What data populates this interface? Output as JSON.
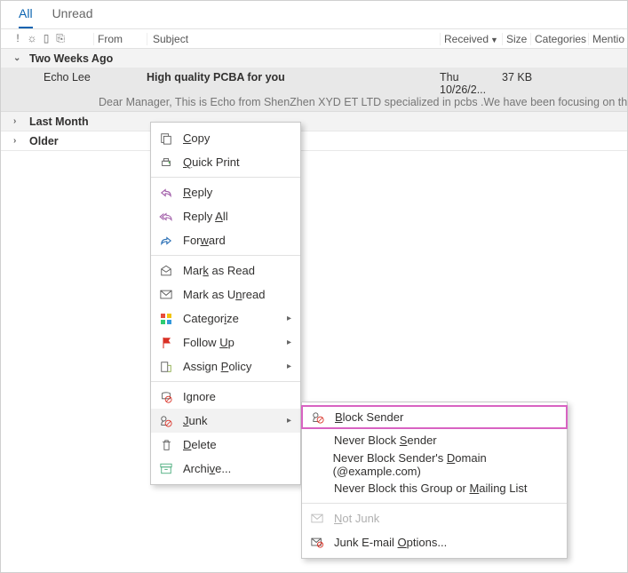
{
  "tabs": {
    "all": "All",
    "unread": "Unread",
    "active": "all"
  },
  "columns": {
    "from": "From",
    "subject": "Subject",
    "received": "Received",
    "size": "Size",
    "categories": "Categories",
    "mention": "Mentio"
  },
  "groups": {
    "twoWeeks": "Two Weeks Ago",
    "lastMonth": "Last Month",
    "older": "Older"
  },
  "message": {
    "from": "Echo Lee",
    "subject": "High quality PCBA for you",
    "received": "Thu 10/26/2...",
    "size": "37 KB",
    "preview": "Dear Manager,  This is Echo from ShenZhen XYD ET LTD specialized in pcbs .We have been focusing on this field for se"
  },
  "contextMenu": {
    "copy": "Copy",
    "quickPrint": "Quick Print",
    "reply": "Reply",
    "replyAll": "Reply All",
    "forward": "Forward",
    "markRead": "Mark as Read",
    "markUnread": "Mark as Unread",
    "categorize": "Categorize",
    "followUp": "Follow Up",
    "assignPolicy": "Assign Policy",
    "ignore": "Ignore",
    "junk": "Junk",
    "delete": "Delete",
    "archive": "Archive..."
  },
  "junkSubmenu": {
    "blockSender": "Block Sender",
    "neverBlockSender": "Never Block Sender",
    "neverBlockDomain": "Never Block Sender's Domain (@example.com)",
    "neverBlockGroup": "Never Block this Group or Mailing List",
    "notJunk": "Not Junk",
    "junkOptions": "Junk E-mail Options..."
  }
}
